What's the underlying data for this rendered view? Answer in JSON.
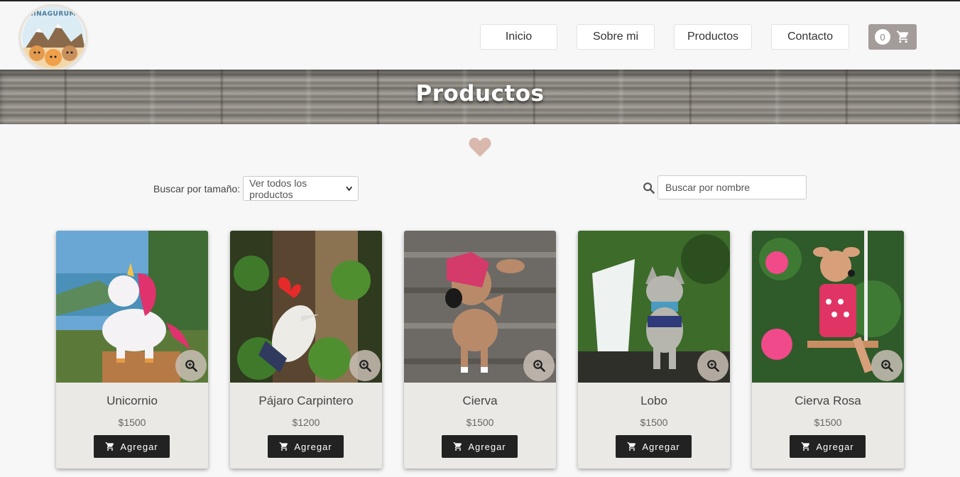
{
  "brand": {
    "logo_text": "CHINAGURUMIS"
  },
  "nav": {
    "items": [
      {
        "label": "Inicio"
      },
      {
        "label": "Sobre mi"
      },
      {
        "label": "Productos"
      },
      {
        "label": "Contacto"
      }
    ],
    "cart_count": "0"
  },
  "banner": {
    "title": "Productos"
  },
  "filters": {
    "size_label": "Buscar por tamaño:",
    "size_selected": "Ver todos los productos",
    "search_placeholder": "Buscar por nombre"
  },
  "products": [
    {
      "name": "Unicornio",
      "price": "$1500",
      "button": "Agregar"
    },
    {
      "name": "Pájaro Carpintero",
      "price": "$1200",
      "button": "Agregar"
    },
    {
      "name": "Cierva",
      "price": "$1500",
      "button": "Agregar"
    },
    {
      "name": "Lobo",
      "price": "$1500",
      "button": "Agregar"
    },
    {
      "name": "Cierva Rosa",
      "price": "$1500",
      "button": "Agregar"
    }
  ],
  "colors": {
    "accent_heart": "#d9b8ad",
    "cart_bg": "#a49c9a",
    "button_dark": "#222222",
    "card_bg": "#ebe9e5"
  },
  "icons": [
    "cart-icon",
    "search-icon",
    "heart-icon",
    "zoom-in-icon",
    "chevron-down-icon"
  ]
}
